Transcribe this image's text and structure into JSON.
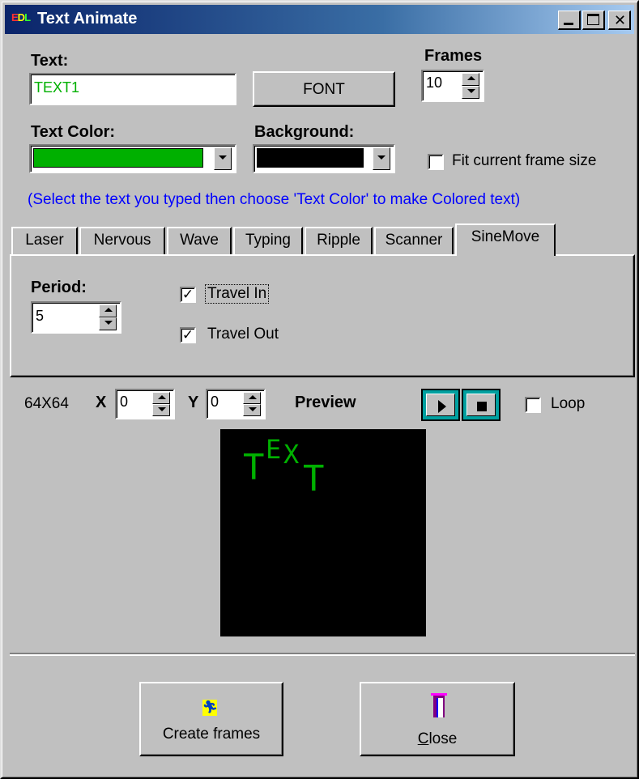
{
  "window": {
    "title": "Text Animate",
    "app_icon_text": [
      "E",
      "D",
      "L"
    ]
  },
  "form": {
    "text_label": "Text:",
    "text_value": "TEXT1",
    "font_button": "FONT",
    "frames_label": "Frames",
    "frames_value": "10",
    "text_color_label": "Text Color:",
    "text_color_value": "#00b000",
    "background_label": "Background:",
    "background_value": "#000000",
    "fit_frame_label": "Fit current frame size",
    "fit_frame_checked": false,
    "hint": "(Select the text you typed then choose 'Text Color' to make Colored text)"
  },
  "tabs": [
    {
      "label": "Laser",
      "active": false
    },
    {
      "label": "Nervous",
      "active": false
    },
    {
      "label": "Wave",
      "active": false
    },
    {
      "label": "Typing",
      "active": false
    },
    {
      "label": "Ripple",
      "active": false
    },
    {
      "label": "Scanner",
      "active": false
    },
    {
      "label": "SineMove",
      "active": true
    }
  ],
  "sinemove": {
    "period_label": "Period:",
    "period_value": "5",
    "travel_in_label": "Travel In",
    "travel_in_checked": true,
    "travel_out_label": "Travel Out",
    "travel_out_checked": true
  },
  "preview": {
    "size": "64X64",
    "x_label": "X",
    "x_value": "0",
    "y_label": "Y",
    "y_value": "0",
    "title": "Preview",
    "loop_label": "Loop",
    "loop_checked": false,
    "letters": [
      "T",
      "E",
      "X",
      "T"
    ],
    "text_color": "#00b000"
  },
  "buttons": {
    "create_frames": "Create frames",
    "close_prefix": "C",
    "close_rest": "lose"
  }
}
